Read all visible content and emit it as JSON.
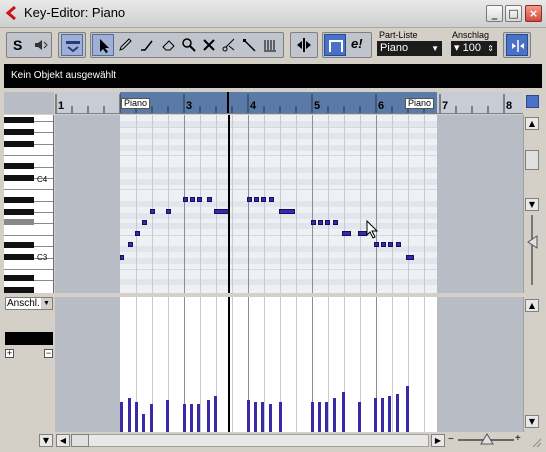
{
  "window": {
    "title": "Key-Editor: Piano",
    "accent": "#c81414"
  },
  "toolbar": {
    "part_list_label": "Part-Liste",
    "part_list_value": "Piano",
    "velocity_label": "Anschlag",
    "velocity_value": "100",
    "solo_label": "S",
    "edit_label": "e!",
    "icons": [
      "solo-icon",
      "speaker-icon",
      "info-line-icon",
      "arrow-icon",
      "pencil-icon",
      "line-icon",
      "eraser-icon",
      "zoom-icon",
      "mute-x-icon",
      "scissors-icon",
      "glue-icon",
      "drumstick-icon",
      "autoscroll-icon",
      "snap-icon",
      "quantize-icon"
    ]
  },
  "info_line": {
    "text": "Kein Objekt ausgewählt"
  },
  "ruler": {
    "bars": [
      "1",
      "2",
      "3",
      "4",
      "5",
      "6",
      "7",
      "8"
    ],
    "part_start_label": "Piano",
    "part_end_label": "Piano"
  },
  "keyboard": {
    "labels": [
      "C4",
      "C3"
    ]
  },
  "velocity_lane": {
    "selector_label": "Anschl.",
    "add_label": "+",
    "remove_label": "−"
  },
  "colors": {
    "note": "#3a2aa8",
    "grid_bg": "#eef0f4",
    "part_range": "#5a7aa8"
  }
}
